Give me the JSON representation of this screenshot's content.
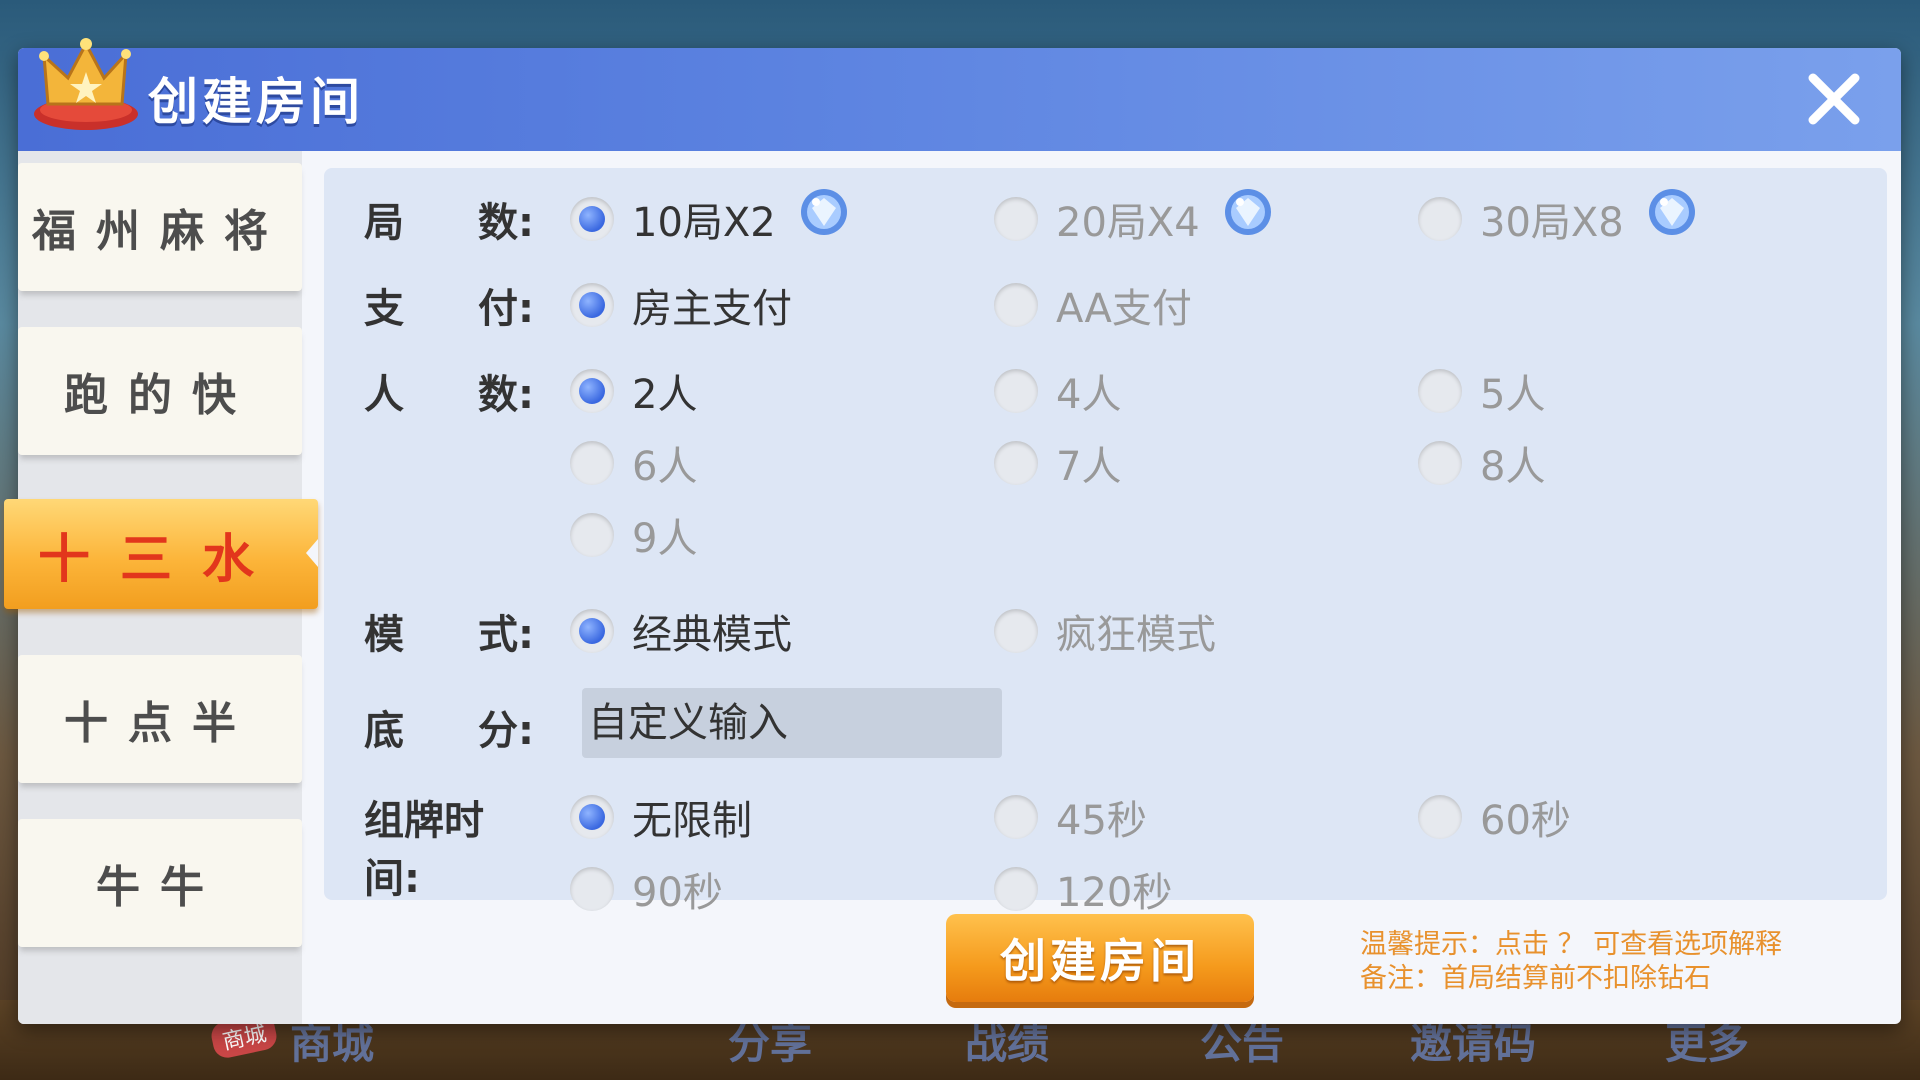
{
  "background_nav": {
    "shop_badge": "商城",
    "items": [
      "商城",
      "分享",
      "战绩",
      "公告",
      "邀请码",
      "更多"
    ]
  },
  "dialog": {
    "title": "创建房间",
    "close_icon": "close-icon"
  },
  "sidebar": {
    "tabs": [
      {
        "label": "福州麻将",
        "active": false
      },
      {
        "label": "跑的快",
        "active": false
      },
      {
        "label": "十三水",
        "active": true
      },
      {
        "label": "十点半",
        "active": false
      },
      {
        "label": "牛牛",
        "active": false
      }
    ]
  },
  "form": {
    "rounds": {
      "label_a": "局",
      "label_b": "数:",
      "options": [
        "10局X2",
        "20局X4",
        "30局X8"
      ],
      "selected": 0,
      "cost_icon": "diamond-icon"
    },
    "payment": {
      "label_a": "支",
      "label_b": "付:",
      "options": [
        "房主支付",
        "AA支付"
      ],
      "selected": 0
    },
    "players": {
      "label_a": "人",
      "label_b": "数:",
      "options": [
        "2人",
        "4人",
        "5人",
        "6人",
        "7人",
        "8人",
        "9人"
      ],
      "selected": 0
    },
    "mode": {
      "label_a": "模",
      "label_b": "式:",
      "options": [
        "经典模式",
        "疯狂模式"
      ],
      "selected": 0
    },
    "base_score": {
      "label_a": "底",
      "label_b": "分:",
      "value": "自定义输入"
    },
    "arrange_time": {
      "label": "组牌时间:",
      "options": [
        "无限制",
        "45秒",
        "60秒",
        "90秒",
        "120秒"
      ],
      "selected": 0
    }
  },
  "create_button": "创建房间",
  "tips": {
    "line1": "温馨提示：点击 ？ 可查看选项解释",
    "line2": "备注：首局结算前不扣除钻石"
  },
  "colors": {
    "accent_blue": "#4a6ed6",
    "orange": "#f59a1c",
    "tab_active_text": "#e2361c"
  }
}
